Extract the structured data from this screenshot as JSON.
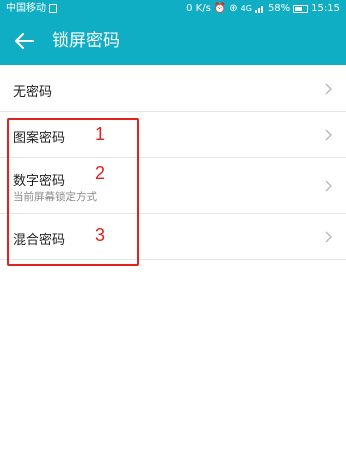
{
  "status": {
    "carrier": "中国移动",
    "speed": "0 K/s",
    "signal": "4G",
    "battery": "58%",
    "time": "15:15"
  },
  "header": {
    "title": "锁屏密码"
  },
  "options": [
    {
      "label": "无密码",
      "sub": ""
    },
    {
      "label": "图案密码",
      "sub": ""
    },
    {
      "label": "数字密码",
      "sub": "当前屏幕锁定方式"
    },
    {
      "label": "混合密码",
      "sub": ""
    }
  ],
  "annotations": [
    "1",
    "2",
    "3"
  ],
  "colors": {
    "accent": "#10aec4",
    "annotation": "#e0231f"
  }
}
